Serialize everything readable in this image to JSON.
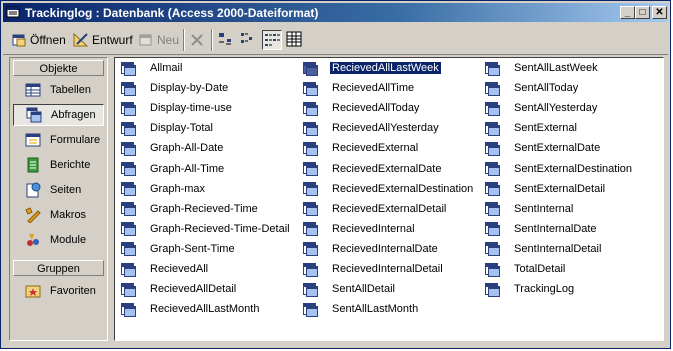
{
  "window": {
    "title": "Trackinglog : Datenbank (Access 2000-Dateiformat)",
    "controls": {
      "minimize": "_",
      "maximize": "□",
      "close": "✕"
    }
  },
  "toolbar": {
    "open_label": "Öffnen",
    "design_label": "Entwurf",
    "new_label": "Neu"
  },
  "objects_panel": {
    "header": "Objekte",
    "items": [
      {
        "label": "Tabellen",
        "icon": "table-icon"
      },
      {
        "label": "Abfragen",
        "icon": "query-icon"
      },
      {
        "label": "Formulare",
        "icon": "form-icon"
      },
      {
        "label": "Berichte",
        "icon": "report-icon"
      },
      {
        "label": "Seiten",
        "icon": "page-icon"
      },
      {
        "label": "Makros",
        "icon": "macro-icon"
      },
      {
        "label": "Module",
        "icon": "module-icon"
      }
    ],
    "groups_header": "Gruppen",
    "favorites_label": "Favoriten"
  },
  "queries": {
    "col1": [
      "Allmail",
      "Display-by-Date",
      "Display-time-use",
      "Display-Total",
      "Graph-All-Date",
      "Graph-All-Time",
      "Graph-max",
      "Graph-Recieved-Time",
      "Graph-Recieved-Time-Detail",
      "Graph-Sent-Time",
      "RecievedAll",
      "RecievedAllDetail",
      "RecievedAllLastMonth"
    ],
    "col2": [
      "RecievedAllLastWeek",
      "RecievedAllTime",
      "RecievedAllToday",
      "RecievedAllYesterday",
      "RecievedExternal",
      "RecievedExternalDate",
      "RecievedExternalDestination",
      "RecievedExternalDetail",
      "RecievedInternal",
      "RecievedInternalDate",
      "RecievedInternalDetail",
      "SentAllDetail",
      "SentAllLastMonth"
    ],
    "col3": [
      "SentAllLastWeek",
      "SentAllToday",
      "SentAllYesterday",
      "SentExternal",
      "SentExternalDate",
      "SentExternalDestination",
      "SentExternalDetail",
      "SentInternal",
      "SentInternalDate",
      "SentInternalDetail",
      "TotalDetail",
      "TrackingLog"
    ],
    "selected": "RecievedAllLastWeek"
  }
}
